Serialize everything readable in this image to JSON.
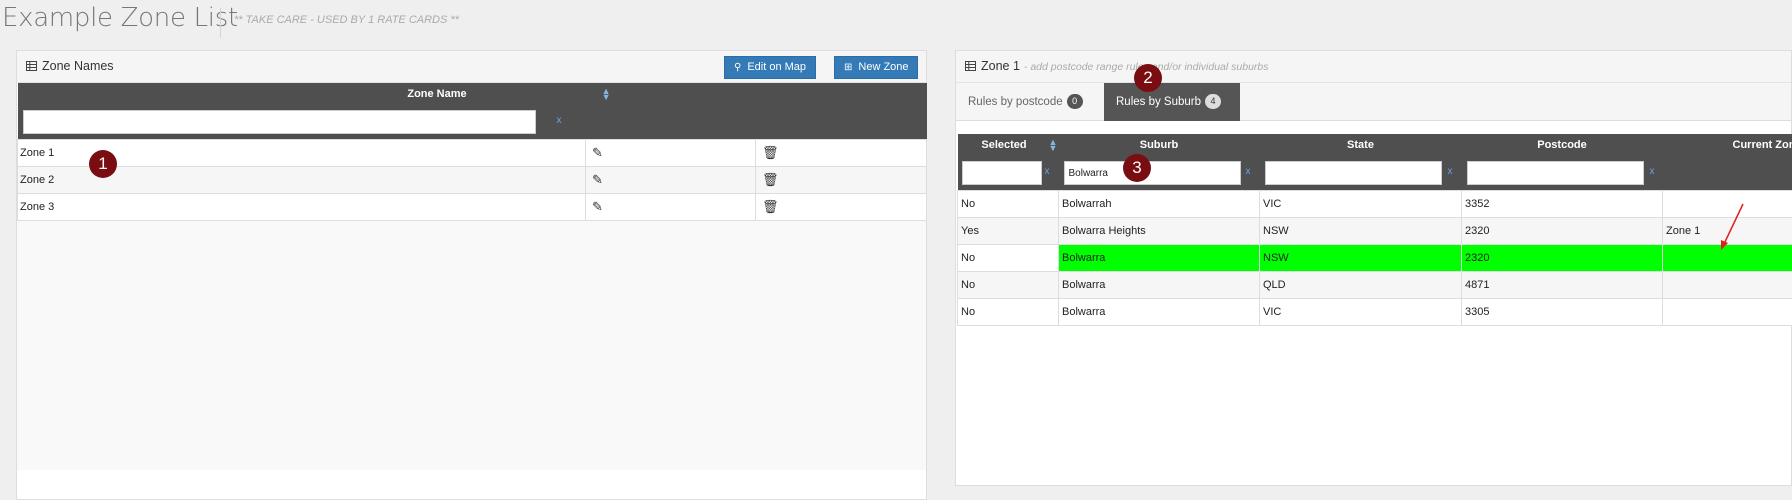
{
  "page": {
    "title": "Example Zone List",
    "subtitle": "** TAKE CARE - USED BY 1 RATE CARDS **"
  },
  "left_panel": {
    "title": "Zone Names",
    "edit_on_map_label": "Edit on Map",
    "new_zone_label": "New Zone",
    "column_header": "Zone Name",
    "filter_value": "",
    "clear_label": "x",
    "rows": [
      {
        "name": "Zone 1"
      },
      {
        "name": "Zone 2"
      },
      {
        "name": "Zone 3"
      }
    ]
  },
  "right_panel": {
    "title": "Zone 1",
    "note": "- add postcode range rules and/or individual suburbs",
    "tabs": [
      {
        "label": "Rules by postcode",
        "count": "0",
        "active": false
      },
      {
        "label": "Rules by Suburb",
        "count": "4",
        "active": true
      }
    ],
    "columns": [
      "Selected",
      "Suburb",
      "State",
      "Postcode",
      "Current Zone"
    ],
    "filters": {
      "selected": "",
      "suburb": "Bolwarra",
      "state": "",
      "postcode": ""
    },
    "clear_label": "x",
    "rows": [
      {
        "selected": "No",
        "suburb": "Bolwarrah",
        "state": "VIC",
        "postcode": "3352",
        "zone": ""
      },
      {
        "selected": "Yes",
        "suburb": "Bolwarra Heights",
        "state": "NSW",
        "postcode": "2320",
        "zone": "Zone 1"
      },
      {
        "selected": "No",
        "suburb": "Bolwarra",
        "state": "NSW",
        "postcode": "2320",
        "zone": ""
      },
      {
        "selected": "No",
        "suburb": "Bolwarra",
        "state": "QLD",
        "postcode": "4871",
        "zone": ""
      },
      {
        "selected": "No",
        "suburb": "Bolwarra",
        "state": "VIC",
        "postcode": "3305",
        "zone": ""
      }
    ]
  },
  "annotations": {
    "markers": [
      "1",
      "2",
      "3"
    ],
    "marker_color": "#7a0d12",
    "arrow_color": "#e02020",
    "highlight_color": "#00ff00"
  },
  "icons": {
    "panel": "table-grid-icon",
    "map": "map-marker-icon",
    "new": "plus-square-icon",
    "edit": "edit-pencil-icon",
    "delete": "trash-icon",
    "sort": "sort-icon"
  }
}
